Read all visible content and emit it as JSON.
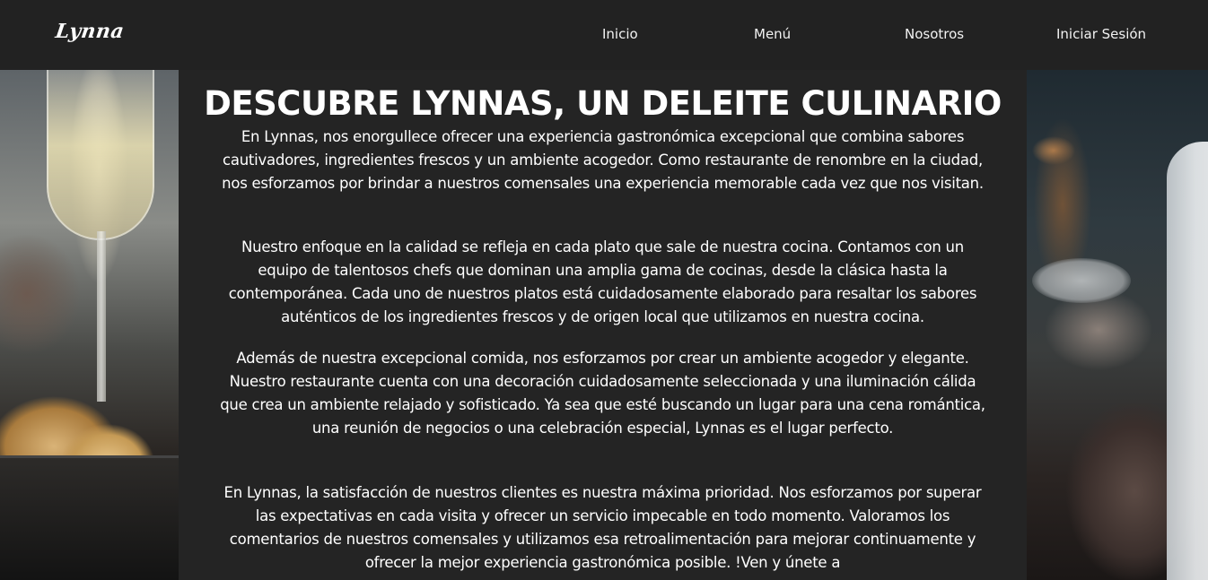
{
  "brand": {
    "logo_text": "Lynna"
  },
  "nav": {
    "items": [
      {
        "label": "Inicio"
      },
      {
        "label": "Menú"
      },
      {
        "label": "Nosotros"
      },
      {
        "label": "Iniciar Sesión"
      }
    ]
  },
  "main": {
    "title": "DESCUBRE LYNNAS, UN DELEITE CULINARIO",
    "paragraphs": [
      "En Lynnas, nos enorgullece ofrecer una experiencia gastronómica excepcional que combina sabores cautivadores, ingredientes frescos y un ambiente acogedor. Como restaurante de renombre en la ciudad, nos esforzamos por brindar a nuestros comensales una experiencia memorable cada vez que nos visitan.",
      "Nuestro enfoque en la calidad se refleja en cada plato que sale de nuestra cocina. Contamos con un equipo de talentosos chefs que dominan una amplia gama de cocinas, desde la clásica hasta la contemporánea. Cada uno de nuestros platos está cuidadosamente elaborado para resaltar los sabores auténticos de los ingredientes frescos y de origen local que utilizamos en nuestra cocina.",
      "Además de nuestra excepcional comida, nos esforzamos por crear un ambiente acogedor y elegante. Nuestro restaurante cuenta con una decoración cuidadosamente seleccionada y una iluminación cálida que crea un ambiente relajado y sofisticado. Ya sea que esté buscando un lugar para una cena romántica, una reunión de negocios o una celebración especial, Lynnas es el lugar perfecto.",
      "En Lynnas, la satisfacción de nuestros clientes es nuestra máxima prioridad. Nos esforzamos por superar las expectativas en cada visita y ofrecer un servicio impecable en todo momento. Valoramos los comentarios de nuestros comensales y utilizamos esa retroalimentación para mejorar continuamente y ofrecer la mejor experiencia gastronómica posible. !Ven y únete a"
    ]
  },
  "colors": {
    "navbar_bg": "#222222",
    "panel_bg": "#242424",
    "text": "#ffffff"
  }
}
